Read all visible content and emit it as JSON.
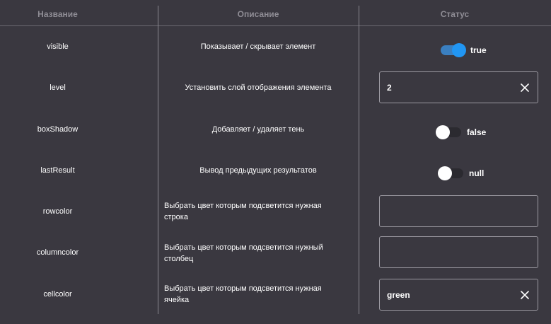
{
  "headers": {
    "name": "Название",
    "description": "Описание",
    "status": "Статус"
  },
  "rows": [
    {
      "name": "visible",
      "description": "Показывает / скрывает элемент",
      "status_type": "toggle",
      "toggle_on": true,
      "status_text": "true"
    },
    {
      "name": "level",
      "description": "Установить слой отображения элемента",
      "status_type": "input",
      "value": "2"
    },
    {
      "name": "boxShadow",
      "description": "Добавляет / удаляет тень",
      "status_type": "toggle",
      "toggle_on": false,
      "status_text": "false"
    },
    {
      "name": "lastResult",
      "description": "Вывод предыдущих результатов",
      "status_type": "toggle",
      "toggle_on": false,
      "status_text": "null"
    },
    {
      "name": "rowcolor",
      "description_line1": "Выбрать цвет которым подсветится нужная",
      "description_line2": "строка",
      "status_type": "input",
      "value": ""
    },
    {
      "name": "columncolor",
      "description_line1": "Выбрать цвет которым подсветится нужный",
      "description_line2": "столбец",
      "status_type": "input",
      "value": ""
    },
    {
      "name": "cellcolor",
      "description_line1": "Выбрать цвет которым подсветится нужная",
      "description_line2": "ячейка",
      "status_type": "input",
      "value": "green"
    }
  ],
  "colors": {
    "background": "#3a3840",
    "toggle_on": "#2196f3",
    "header_text": "#8f8d95"
  },
  "icons": {
    "clear": "close-icon"
  }
}
